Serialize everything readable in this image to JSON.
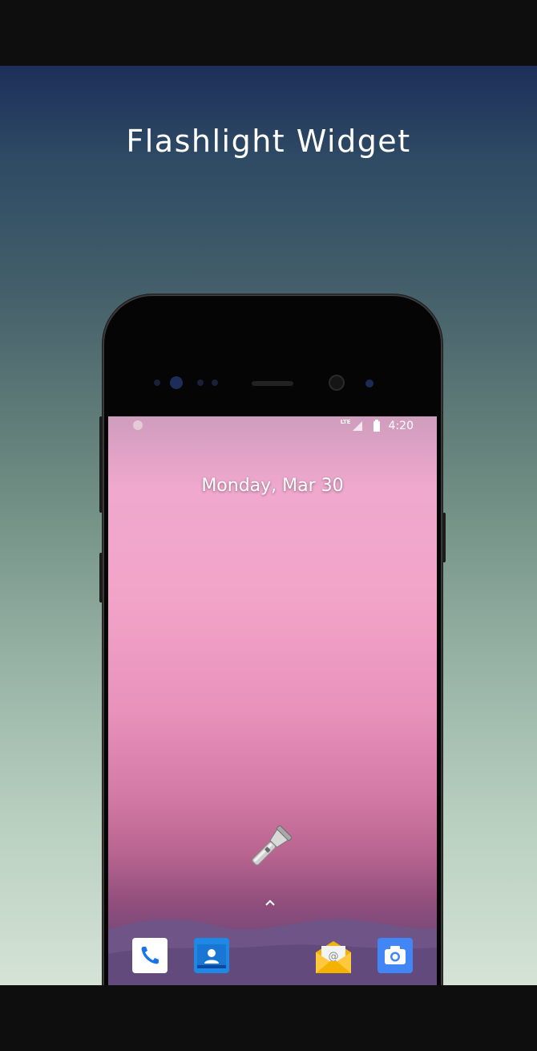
{
  "promo": {
    "title": "Flashlight Widget"
  },
  "status_bar": {
    "network": "LTE",
    "time": "4:20"
  },
  "home_screen": {
    "date": "Monday, Mar 30",
    "widget_icon": "flashlight-icon",
    "dock_apps": [
      {
        "name": "phone-app-icon"
      },
      {
        "name": "contacts-app-icon"
      },
      {
        "name": "email-app-icon"
      },
      {
        "name": "camera-app-icon"
      }
    ],
    "search_bar_icon": "google-g-icon"
  },
  "colors": {
    "promo_top": "#1c2f59",
    "promo_bottom": "#d5e3d6",
    "wallpaper_pink": "#f0a8ce",
    "wallpaper_purple": "#5b4470"
  }
}
